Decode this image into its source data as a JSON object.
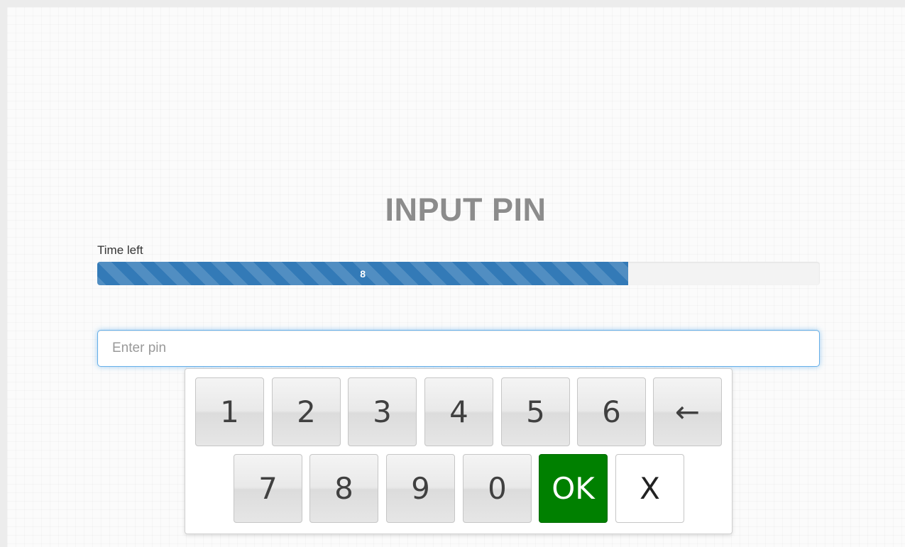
{
  "title": "INPUT PIN",
  "timer": {
    "label": "Time left",
    "value": "8",
    "fill_fraction": 0.735
  },
  "pin_input": {
    "placeholder": "Enter pin",
    "value": ""
  },
  "keypad": {
    "row1": [
      "1",
      "2",
      "3",
      "4",
      "5",
      "6",
      "←"
    ],
    "row2": [
      "7",
      "8",
      "9",
      "0",
      "OK",
      "X"
    ]
  },
  "colors": {
    "progress": "#337ab7",
    "ok_button": "#008000",
    "title": "#8c8c8c"
  }
}
